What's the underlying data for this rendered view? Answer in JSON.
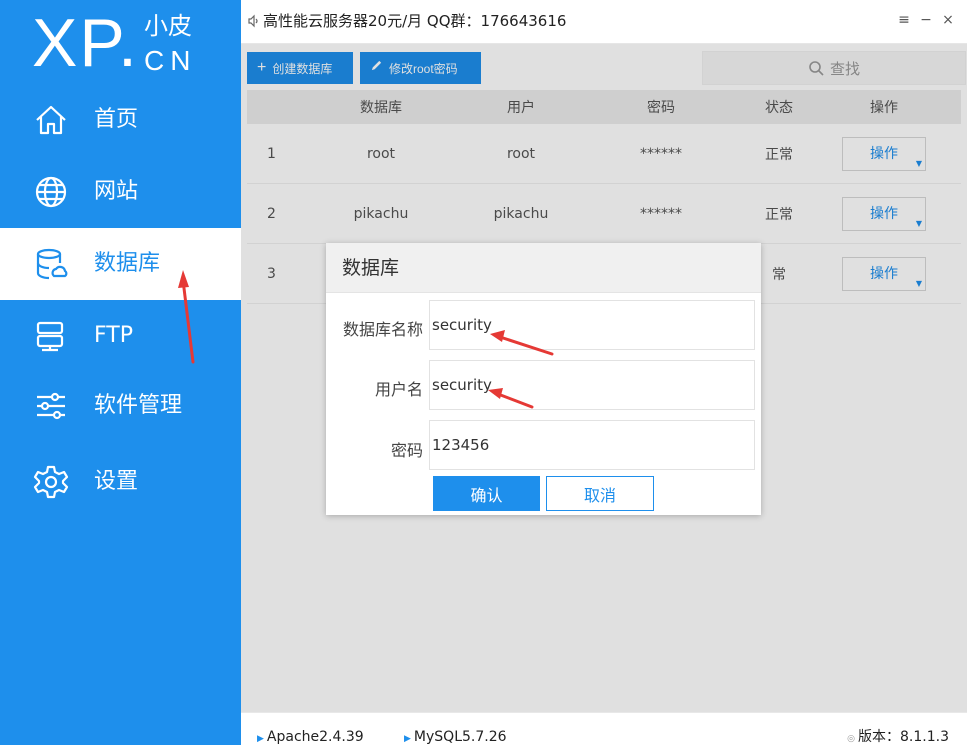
{
  "logo": {
    "main": "XP.",
    "cn": "小皮",
    "domain": "CN"
  },
  "sidebar": {
    "items": [
      {
        "label": "首页",
        "icon": "home-icon"
      },
      {
        "label": "网站",
        "icon": "globe-icon"
      },
      {
        "label": "数据库",
        "icon": "database-icon",
        "active": true
      },
      {
        "label": "FTP",
        "icon": "server-icon"
      },
      {
        "label": "软件管理",
        "icon": "sliders-icon"
      },
      {
        "label": "设置",
        "icon": "gear-icon"
      }
    ]
  },
  "topbar": {
    "notice": "高性能云服务器20元/月  QQ群：176643616",
    "menu": "≡",
    "minimize": "−",
    "close": "×"
  },
  "toolbar": {
    "create_label": "创建数据库",
    "change_pwd_label": "修改root密码",
    "search_label": "查找"
  },
  "table": {
    "headers": [
      "",
      "数据库",
      "用户",
      "密码",
      "状态",
      "操作"
    ],
    "rows": [
      {
        "index": "1",
        "database": "root",
        "user": "root",
        "password": "******",
        "status": "正常",
        "action": "操作"
      },
      {
        "index": "2",
        "database": "pikachu",
        "user": "pikachu",
        "password": "******",
        "status": "正常",
        "action": "操作"
      },
      {
        "index": "3",
        "database": "",
        "user": "",
        "password": "",
        "status": "常",
        "action": "操作"
      }
    ]
  },
  "modal": {
    "title": "数据库",
    "fields": [
      {
        "label": "数据库名称",
        "value": "security"
      },
      {
        "label": "用户名",
        "value": "security"
      },
      {
        "label": "密码",
        "value": "123456"
      }
    ],
    "ok_label": "确认",
    "cancel_label": "取消"
  },
  "statusbar": {
    "apache": "Apache2.4.39",
    "mysql": "MySQL5.7.26",
    "version": "版本：8.1.1.3"
  },
  "colors": {
    "accent": "#1e8fec",
    "annotation": "#e53935"
  }
}
